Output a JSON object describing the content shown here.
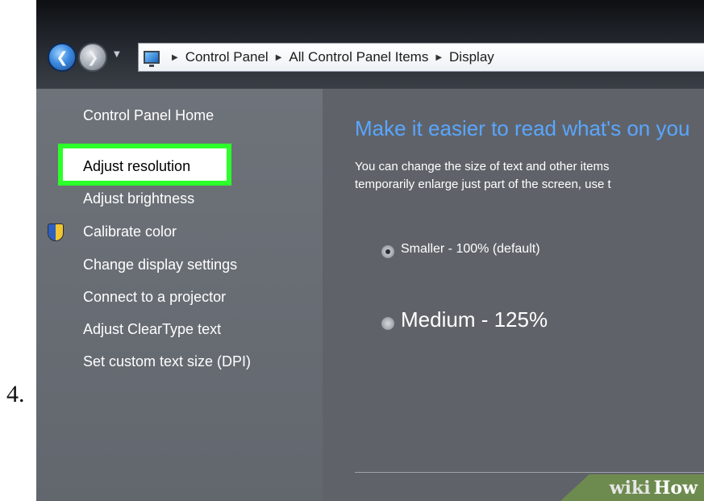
{
  "step": {
    "number": "4."
  },
  "navigation": {
    "back_icon": "back-arrow-icon",
    "forward_icon": "forward-arrow-icon",
    "breadcrumb": [
      "Control Panel",
      "All Control Panel Items",
      "Display"
    ]
  },
  "sidebar": {
    "items": [
      {
        "label": "Control Panel Home"
      },
      {
        "label": "Adjust resolution",
        "highlighted": true
      },
      {
        "label": "Adjust brightness"
      },
      {
        "label": "Calibrate color",
        "icon": "shield-icon"
      },
      {
        "label": "Change display settings"
      },
      {
        "label": "Connect to a projector"
      },
      {
        "label": "Adjust ClearType text"
      },
      {
        "label": "Set custom text size (DPI)"
      }
    ]
  },
  "main": {
    "heading": "Make it easier to read what's on you",
    "description_line1": "You can change the size of text and other items",
    "description_line2": "temporarily enlarge just part of the screen, use t",
    "options": [
      {
        "label": "Smaller - 100% (default)",
        "selected": true
      },
      {
        "label": "Medium - 125%",
        "selected": false
      }
    ]
  },
  "watermark": {
    "wiki": "wiki",
    "how": "How"
  },
  "colors": {
    "highlight": "#2cff2a",
    "heading": "#5aa6ff",
    "watermark_bg": "#6e8b4f"
  }
}
